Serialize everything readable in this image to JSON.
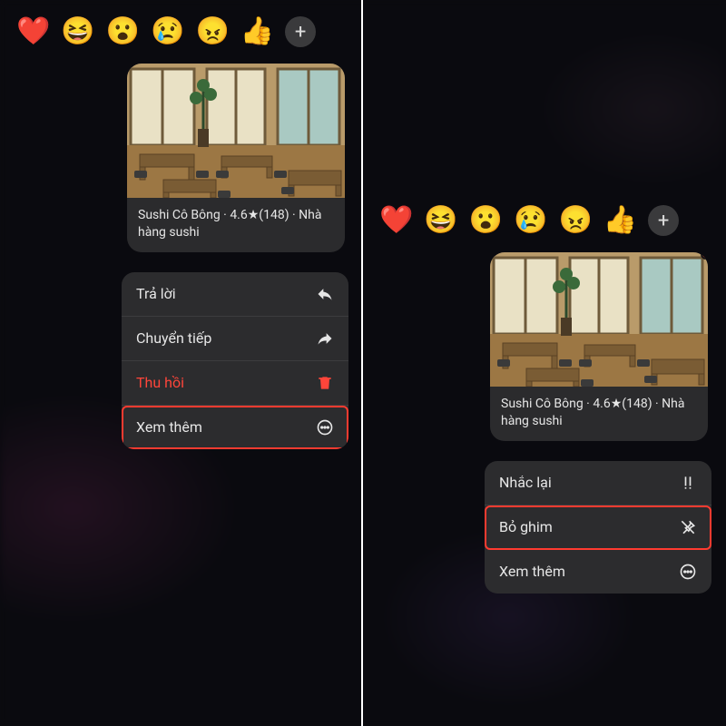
{
  "reactions": {
    "heart": "❤️",
    "laugh": "😆",
    "wow": "😮",
    "cry": "😢",
    "angry": "😠",
    "like": "👍"
  },
  "card": {
    "caption": "Sushi Cô Bông · 4.6★(148) · Nhà hàng sushi"
  },
  "menu_left": {
    "reply": "Trả lời",
    "forward": "Chuyển tiếp",
    "recall": "Thu hồi",
    "more": "Xem thêm"
  },
  "menu_right": {
    "remind": "Nhắc lại",
    "unpin": "Bỏ ghim",
    "more": "Xem thêm"
  }
}
